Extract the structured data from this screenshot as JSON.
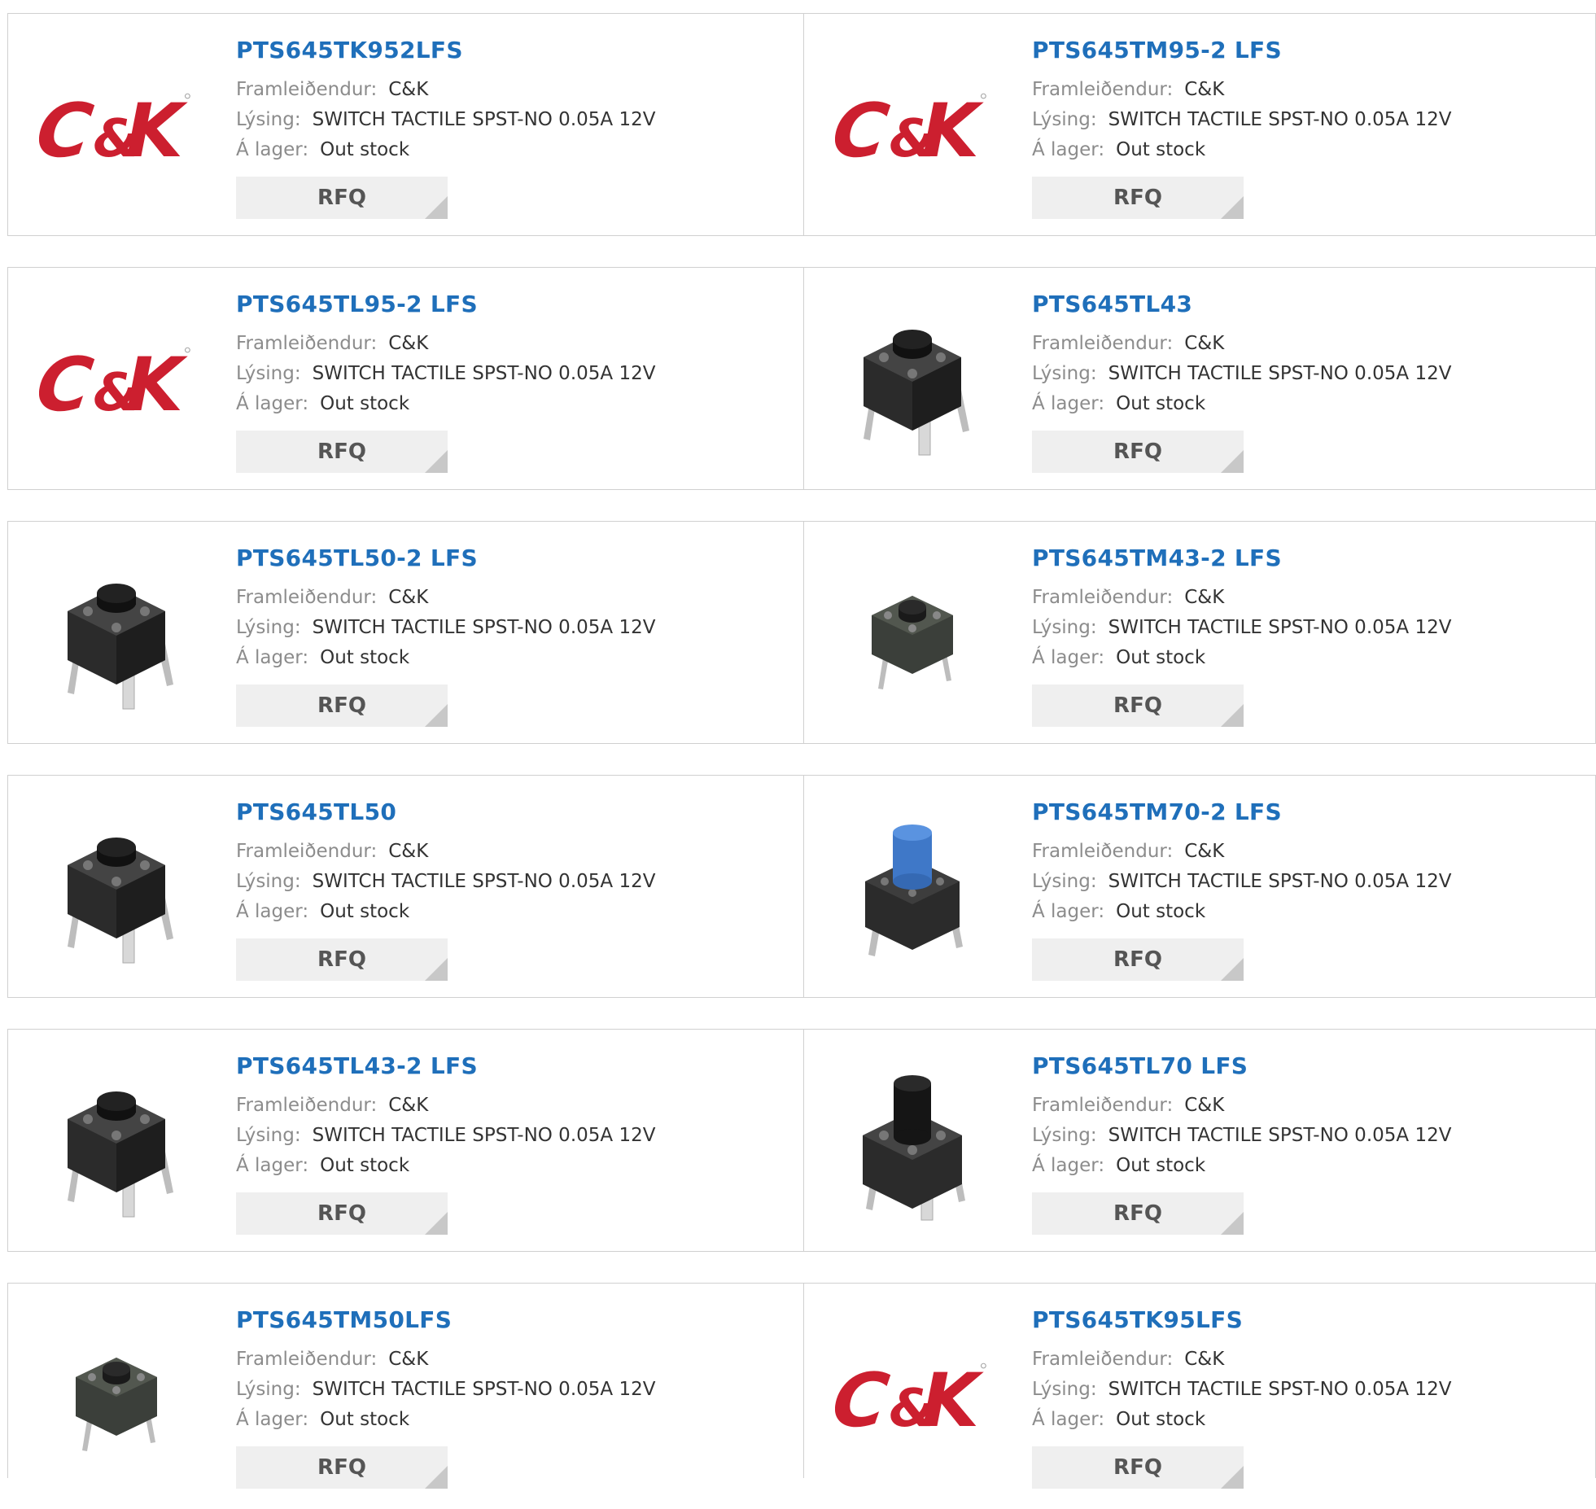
{
  "labels": {
    "manufacturer": "Framleiðendur:",
    "description": "Lýsing:",
    "stock": "Á lager:",
    "rfq": "RFQ"
  },
  "colors": {
    "title": "#1f6fba",
    "logo_red": "#cc1f2f",
    "button_bg": "#efefef"
  },
  "products": [
    {
      "part": "PTS645TK952LFS",
      "manufacturer": "C&K",
      "description": "SWITCH TACTILE SPST-NO 0.05A 12V",
      "stock": "Out stock",
      "image": "ck-logo"
    },
    {
      "part": "PTS645TM95-2 LFS",
      "manufacturer": "C&K",
      "description": "SWITCH TACTILE SPST-NO 0.05A 12V",
      "stock": "Out stock",
      "image": "ck-logo"
    },
    {
      "part": "PTS645TL95-2 LFS",
      "manufacturer": "C&K",
      "description": "SWITCH TACTILE SPST-NO 0.05A 12V",
      "stock": "Out stock",
      "image": "ck-logo"
    },
    {
      "part": "PTS645TL43",
      "manufacturer": "C&K",
      "description": "SWITCH TACTILE SPST-NO 0.05A 12V",
      "stock": "Out stock",
      "image": "switch-black"
    },
    {
      "part": "PTS645TL50-2 LFS",
      "manufacturer": "C&K",
      "description": "SWITCH TACTILE SPST-NO 0.05A 12V",
      "stock": "Out stock",
      "image": "switch-black"
    },
    {
      "part": "PTS645TM43-2 LFS",
      "manufacturer": "C&K",
      "description": "SWITCH TACTILE SPST-NO 0.05A 12V",
      "stock": "Out stock",
      "image": "switch-small"
    },
    {
      "part": "PTS645TL50",
      "manufacturer": "C&K",
      "description": "SWITCH TACTILE SPST-NO 0.05A 12V",
      "stock": "Out stock",
      "image": "switch-black"
    },
    {
      "part": "PTS645TM70-2 LFS",
      "manufacturer": "C&K",
      "description": "SWITCH TACTILE SPST-NO 0.05A 12V",
      "stock": "Out stock",
      "image": "switch-blue"
    },
    {
      "part": "PTS645TL43-2 LFS",
      "manufacturer": "C&K",
      "description": "SWITCH TACTILE SPST-NO 0.05A 12V",
      "stock": "Out stock",
      "image": "switch-black"
    },
    {
      "part": "PTS645TL70 LFS",
      "manufacturer": "C&K",
      "description": "SWITCH TACTILE SPST-NO 0.05A 12V",
      "stock": "Out stock",
      "image": "switch-tall"
    },
    {
      "part": "PTS645TM50LFS",
      "manufacturer": "C&K",
      "description": "SWITCH TACTILE SPST-NO 0.05A 12V",
      "stock": "Out stock",
      "image": "switch-small"
    },
    {
      "part": "PTS645TK95LFS",
      "manufacturer": "C&K",
      "description": "SWITCH TACTILE SPST-NO 0.05A 12V",
      "stock": "Out stock",
      "image": "ck-logo"
    }
  ]
}
